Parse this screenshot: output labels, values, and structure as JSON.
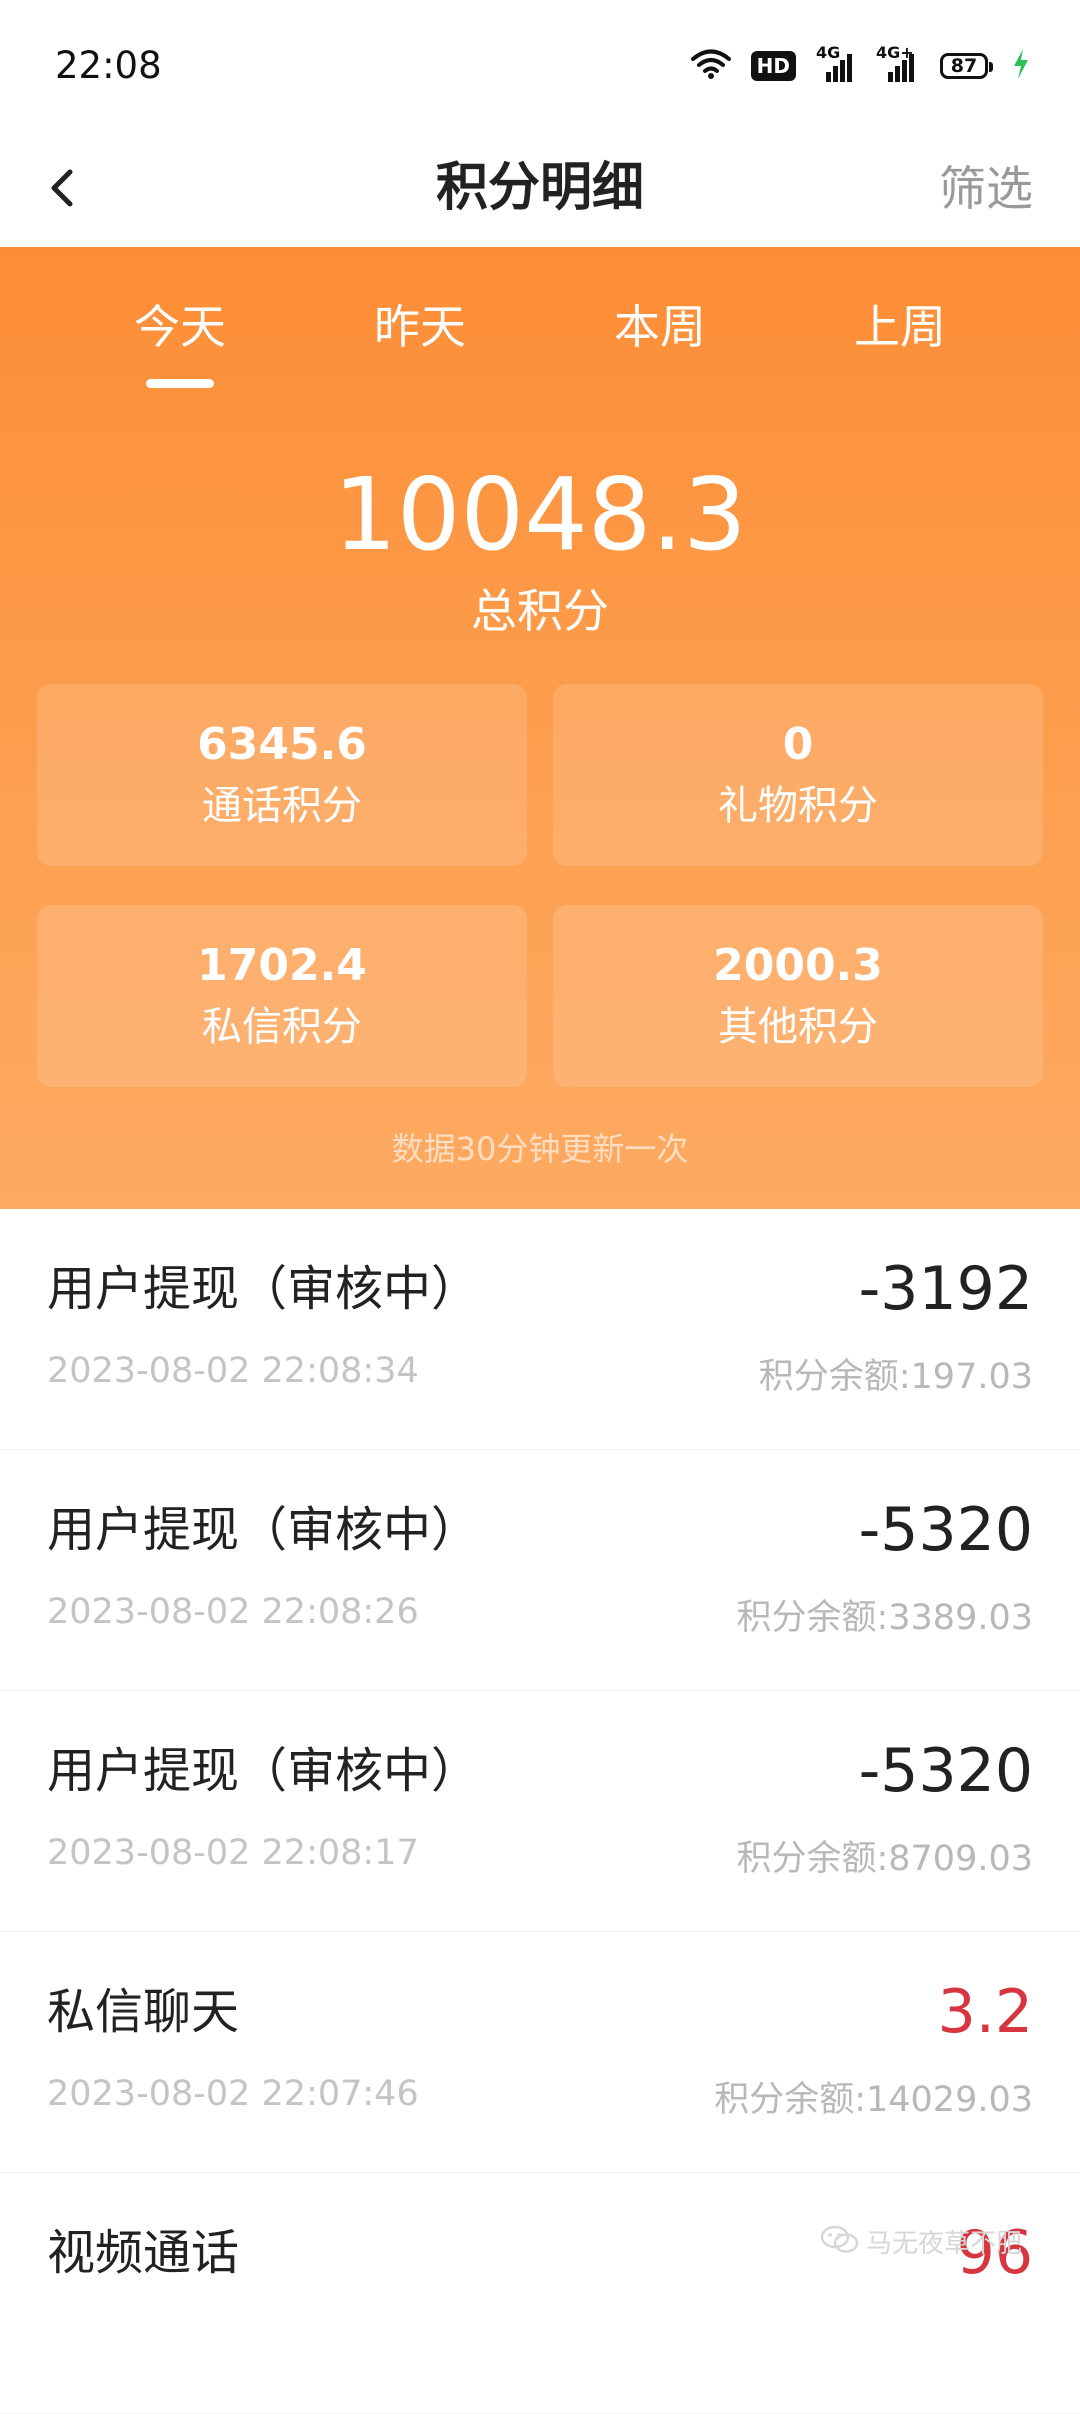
{
  "status_bar": {
    "time": "22:08",
    "hd_label": "HD",
    "sim1_label": "4G",
    "sim2_label": "4G+",
    "battery": "87",
    "icons": [
      "wifi-icon",
      "hd-icon",
      "signal-icon",
      "signal-icon",
      "battery-icon",
      "charging-icon"
    ]
  },
  "header": {
    "back_icon": "chevron-left-icon",
    "title": "积分明细",
    "filter_label": "筛选"
  },
  "panel": {
    "tabs": [
      {
        "label": "今天",
        "active": true
      },
      {
        "label": "昨天",
        "active": false
      },
      {
        "label": "本周",
        "active": false
      },
      {
        "label": "上周",
        "active": false
      }
    ],
    "total_value": "10048.3",
    "total_label": "总积分",
    "cards": [
      {
        "value": "6345.6",
        "label": "通话积分"
      },
      {
        "value": "0",
        "label": "礼物积分"
      },
      {
        "value": "1702.4",
        "label": "私信积分"
      },
      {
        "value": "2000.3",
        "label": "其他积分"
      }
    ],
    "update_note": "数据30分钟更新一次"
  },
  "records": [
    {
      "title": "用户提现（审核中）",
      "time": "2023-08-02 22:08:34",
      "amount": "-3192",
      "balance": "积分余额:197.03",
      "positive": false
    },
    {
      "title": "用户提现（审核中）",
      "time": "2023-08-02 22:08:26",
      "amount": "-5320",
      "balance": "积分余额:3389.03",
      "positive": false
    },
    {
      "title": "用户提现（审核中）",
      "time": "2023-08-02 22:08:17",
      "amount": "-5320",
      "balance": "积分余额:8709.03",
      "positive": false
    },
    {
      "title": "私信聊天",
      "time": "2023-08-02 22:07:46",
      "amount": "3.2",
      "balance": "积分余额:14029.03",
      "positive": true
    },
    {
      "title": "视频通话",
      "time": "",
      "amount": "96",
      "balance": "",
      "positive": true
    }
  ],
  "watermark": {
    "text": "马无夜草不肥",
    "icon": "wechat-icon"
  },
  "colors": {
    "panel_top": "#fd8d35",
    "panel_bottom": "#fdaa62",
    "positive_amount": "#d7353f",
    "filter_text": "#9a9a9a"
  }
}
